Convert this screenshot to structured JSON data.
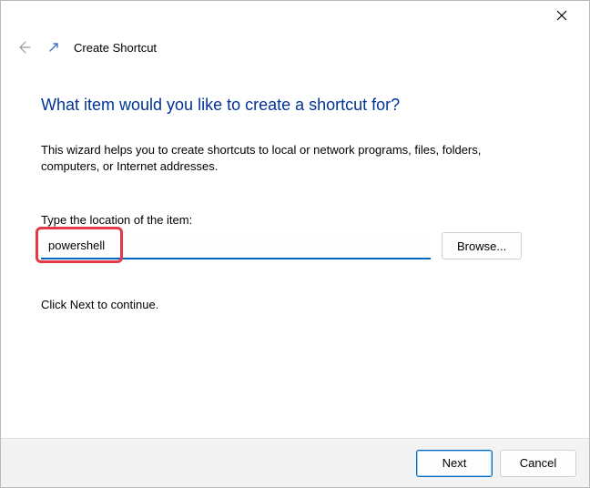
{
  "window": {
    "title": "Create Shortcut"
  },
  "heading": "What item would you like to create a shortcut for?",
  "description": "This wizard helps you to create shortcuts to local or network programs, files, folders, computers, or Internet addresses.",
  "field": {
    "label": "Type the location of the item:",
    "value": "powershell"
  },
  "browse_label": "Browse...",
  "continue_text": "Click Next to continue.",
  "footer": {
    "next": "Next",
    "cancel": "Cancel"
  }
}
